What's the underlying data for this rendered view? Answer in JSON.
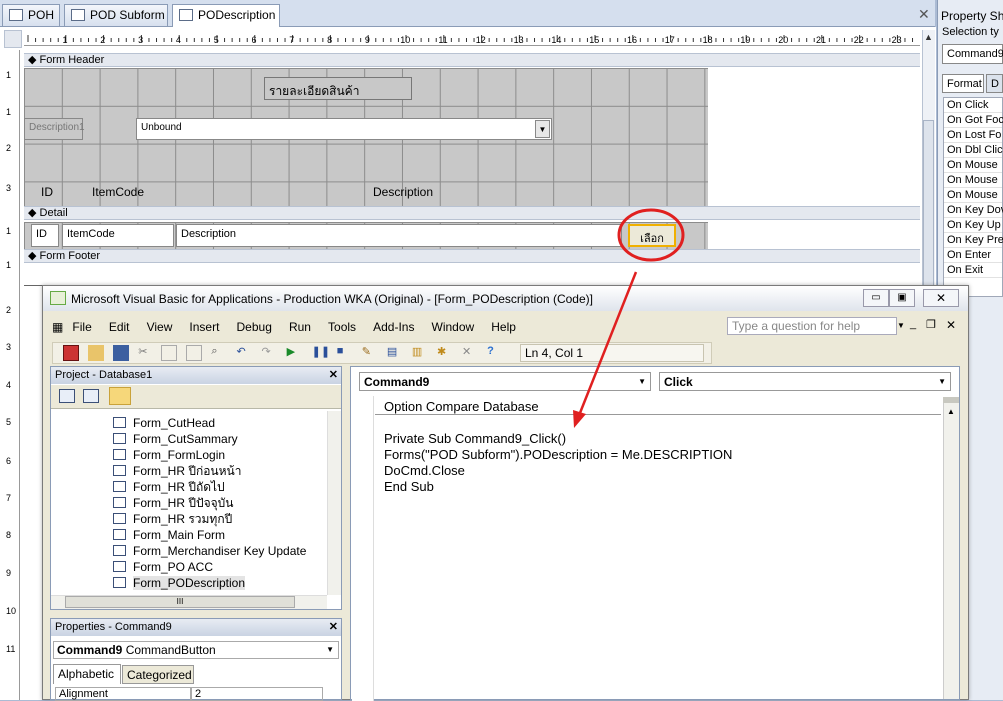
{
  "tabs": [
    {
      "label": "POH"
    },
    {
      "label": "POD Subform"
    },
    {
      "label": "PODescription"
    }
  ],
  "ruler": {
    "marks": [
      "1",
      "2",
      "3",
      "4",
      "5",
      "6",
      "7",
      "8",
      "9",
      "10",
      "11",
      "12",
      "13",
      "14",
      "15",
      "16",
      "17",
      "18",
      "19",
      "20",
      "21",
      "22",
      "23"
    ]
  },
  "vruler": {
    "marks": [
      "1",
      "1",
      "2",
      "3",
      "1",
      "1",
      "2",
      "3",
      "4",
      "5",
      "6",
      "7",
      "8",
      "9",
      "10",
      "11"
    ]
  },
  "sections": {
    "header": "Form Header",
    "detail": "Detail",
    "footer": "Form Footer"
  },
  "header_controls": {
    "title": "รายละเอียดสินค้า",
    "desc_label": "Description1",
    "combo_value": "Unbound",
    "col_id": "ID",
    "col_itemcode": "ItemCode",
    "col_description": "Description"
  },
  "detail_controls": {
    "id": "ID",
    "itemcode": "ItemCode",
    "description": "Description",
    "button": "เลือก"
  },
  "property_sheet": {
    "title": "Property Sh",
    "selection_label": "Selection ty",
    "selected": "Command9",
    "tabs": [
      "Format",
      "D"
    ],
    "events": [
      "On Click",
      "On Got Foc",
      "On Lost Fo",
      "On Dbl Clic",
      "On Mouse",
      "On Mouse",
      "On Mouse",
      "On Key Dov",
      "On Key Up",
      "On Key Pres",
      "On Enter",
      "On Exit"
    ]
  },
  "vba": {
    "title": "Microsoft Visual Basic for Applications - Production WKA (Original) - [Form_PODescription (Code)]",
    "menu": [
      "File",
      "Edit",
      "View",
      "Insert",
      "Debug",
      "Run",
      "Tools",
      "Add-Ins",
      "Window",
      "Help"
    ],
    "help_placeholder": "Type a question for help",
    "position": "Ln 4, Col 1",
    "project_title": "Project - Database1",
    "tree": [
      "Form_CutHead",
      "Form_CutSammary",
      "Form_FormLogin",
      "Form_HR ปีก่อนหน้า",
      "Form_HR ปีถัดไป",
      "Form_HR ปีปัจจุบัน",
      "Form_HR รวมทุกปี",
      "Form_Main Form",
      "Form_Merchandiser Key Update",
      "Form_PO ACC",
      "Form_PODescription"
    ],
    "hscroll_label": "III",
    "props_title": "Properties - Command9",
    "props_object": "Command9",
    "props_type": "CommandButton",
    "props_tabs": [
      "Alphabetic",
      "Categorized"
    ],
    "props_row": {
      "name": "Alignment",
      "value": "2"
    },
    "object_dropdown": "Command9",
    "proc_dropdown": "Click",
    "code_lines": [
      "Option Compare Database",
      "",
      "Private Sub Command9_Click()",
      "Forms(\"POD Subform\").PODescription = Me.DESCRIPTION",
      "DoCmd.Close",
      "End Sub"
    ]
  },
  "colors": {
    "annotation": "#e02020",
    "accent": "#f0b000"
  }
}
